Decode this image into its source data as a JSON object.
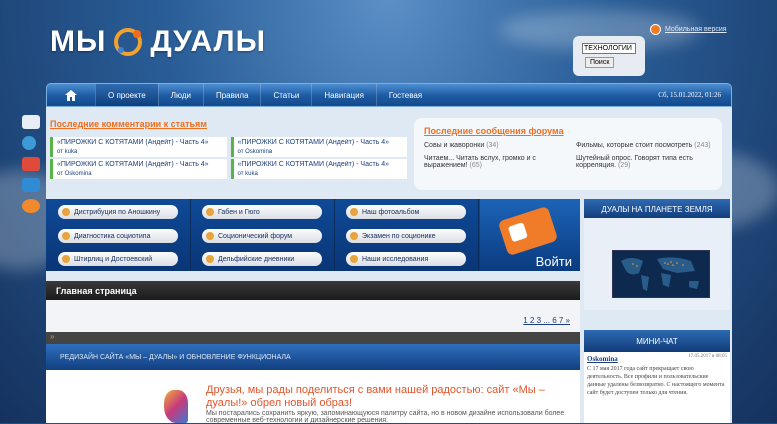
{
  "logo": {
    "left": "МЫ",
    "right": "ДУАЛЫ"
  },
  "header": {
    "mobile_link": "Мобильная версия",
    "search_value": "ТЕХНОЛОГИИ",
    "search_button": "Поиск"
  },
  "nav": {
    "items": [
      "О проекте",
      "Люди",
      "Правила",
      "Статьи",
      "Навигация",
      "Гостевая"
    ],
    "date": "Сб, 15.01.2022, 01:26"
  },
  "comments": {
    "title": "Последние комментарии к статьям",
    "items": [
      {
        "title": "«ПИРОЖКИ С КОТЯТАМИ (Андейт) - Часть 4»",
        "by": "от kuka"
      },
      {
        "title": "«ПИРОЖКИ С КОТЯТАМИ (Андейт) - Часть 4»",
        "by": "от Oskomina"
      },
      {
        "title": "«ПИРОЖКИ С КОТЯТАМИ (Андейт) - Часть 4»",
        "by": "от Oskomina"
      },
      {
        "title": "«ПИРОЖКИ С КОТЯТАМИ (Андейт) - Часть 4»",
        "by": "от kuka"
      }
    ]
  },
  "forum": {
    "title": "Последние сообщения форума",
    "items": [
      {
        "text": "Совы и жаворонки",
        "count": "(34)"
      },
      {
        "text": "Фильмы, которые стоит посмотреть",
        "count": "(243)"
      },
      {
        "text": "Читаем... Читать вслух, громко и с выражением!",
        "count": "(65)"
      },
      {
        "text": "Шутейный опрос. Говорят типа есть корреляция.",
        "count": "(29)"
      }
    ]
  },
  "band": {
    "col1": [
      "Дистрибуция по Аношкину",
      "Диагностика социотипа",
      "Штирлиц и Достоевский"
    ],
    "col2": [
      "Габен и Гюго",
      "Соционический форум",
      "Дельфийские дневники"
    ],
    "col3": [
      "Наш фотоальбом",
      "Экзамен по соционике",
      "Наши исследования"
    ],
    "login": "Войти"
  },
  "main": {
    "title": "Главная страница",
    "pager": "1 2 3 ... 6 7 »",
    "strip": "»",
    "redesign": "РЕДИЗАЙН САЙТА «МЫ – ДУАЛЫ» И ОБНОВЛЕНИЕ ФУНКЦИОНАЛА",
    "headline": "Друзья, мы рады поделиться с вами нашей радостью: сайт «Мы – дуалы!» обрел новый образ!",
    "text": "Мы постарались сохранить яркую, запоминающуюся палитру сайта, но в новом дизайне использовали более современные веб-технологии и дизайнерские решения."
  },
  "widgets": {
    "map_title": "ДУАЛЫ НА ПЛАНЕТЕ ЗЕМЛЯ",
    "chat_title": "МИНИ-ЧАТ",
    "chat_user": "Oskomina",
    "chat_date": "17.05.2017 в 08:05",
    "chat_message": "С 17 мая 2017 года сайт прекращает свою деятельность. Все профили и пользовательские данные удалены безвозвратно. С настоящего момента сайт будет доступен только для чтения."
  },
  "colors": {
    "accent": "#f26d1e",
    "nav": "#1c5aa2",
    "link": "#1a3e7a"
  }
}
